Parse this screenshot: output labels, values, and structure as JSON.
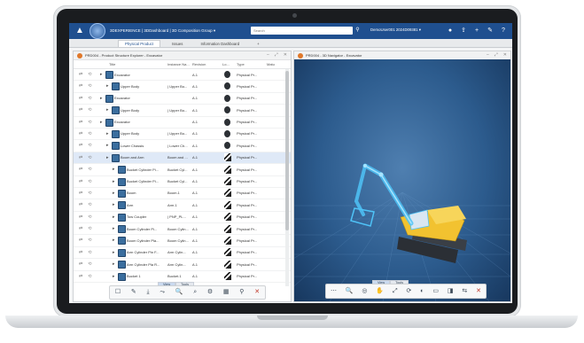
{
  "topbar": {
    "app_title": "3DEXPERIENCE | 3DDashboard | 3D Composition Group ▾",
    "search_placeholder": "Search",
    "user": "DemoUser001 2024D09381 ▾"
  },
  "tabs": [
    {
      "label": "Physical Product",
      "active": true
    },
    {
      "label": "Issues",
      "active": false
    },
    {
      "label": "Information Dashboard",
      "active": false
    },
    {
      "label": "+",
      "active": false
    }
  ],
  "left_panel": {
    "title": "PRD004 - Product Structure Explorer - Excavator",
    "controls": [
      "–",
      "⤢",
      "✕"
    ],
    "columns": [
      "Title",
      "Instance Na...",
      "Revision",
      "Lo...",
      "Type",
      "Matu"
    ],
    "rows": [
      {
        "indent": 0,
        "title": "Excavator",
        "instance": "",
        "revision": "A.1",
        "icon": "lock",
        "type": "Physical Pr...",
        "selected": false
      },
      {
        "indent": 1,
        "title": "Upper Body",
        "instance": "| Upper Bo...",
        "revision": "A.1",
        "icon": "lock",
        "type": "Physical Pr...",
        "selected": false
      },
      {
        "indent": 0,
        "title": "Excavator",
        "instance": "",
        "revision": "A.1",
        "icon": "lock",
        "type": "Physical Pr...",
        "selected": false
      },
      {
        "indent": 1,
        "title": "Upper Body",
        "instance": "| Upper Bo...",
        "revision": "A.1",
        "icon": "lock",
        "type": "Physical Pr...",
        "selected": false
      },
      {
        "indent": 0,
        "title": "Excavator",
        "instance": "",
        "revision": "A.1",
        "icon": "lock",
        "type": "Physical Pr...",
        "selected": false
      },
      {
        "indent": 1,
        "title": "Upper Body",
        "instance": "| Upper Bo...",
        "revision": "A.1",
        "icon": "lock",
        "type": "Physical Pr...",
        "selected": false
      },
      {
        "indent": 1,
        "title": "Lower Chassis",
        "instance": "| Lower Ch...",
        "revision": "A.1",
        "icon": "lock",
        "type": "Physical Pr...",
        "selected": false
      },
      {
        "indent": 1,
        "title": "Boom and Arm",
        "instance": "Boom and ...",
        "revision": "A.1",
        "icon": "thumb",
        "type": "Physical Pr...",
        "selected": true
      },
      {
        "indent": 2,
        "title": "Bucket Cylinder Pi...",
        "instance": "Bucket Cyl...",
        "revision": "A.1",
        "icon": "thumb",
        "type": "Physical Pr...",
        "selected": false
      },
      {
        "indent": 2,
        "title": "Bucket Cylinder Pi...",
        "instance": "Bucket Cyl...",
        "revision": "A.1",
        "icon": "thumb",
        "type": "Physical Pr...",
        "selected": false
      },
      {
        "indent": 2,
        "title": "Boom",
        "instance": "Boom.1",
        "revision": "A.1",
        "icon": "thumb",
        "type": "Physical Pr...",
        "selected": false
      },
      {
        "indent": 2,
        "title": "Arm",
        "instance": "Arm.1",
        "revision": "A.1",
        "icon": "thumb",
        "type": "Physical Pr...",
        "selected": false
      },
      {
        "indent": 2,
        "title": "Tow Coupler",
        "instance": "| PNP_PL...",
        "revision": "A.1",
        "icon": "thumb",
        "type": "Physical Pr...",
        "selected": false
      },
      {
        "indent": 2,
        "title": "Boom Cylinder Pi...",
        "instance": "Boom Cylin...",
        "revision": "A.1",
        "icon": "thumb",
        "type": "Physical Pr...",
        "selected": false
      },
      {
        "indent": 2,
        "title": "Boom Cylinder Pla...",
        "instance": "Boom Cylin...",
        "revision": "A.1",
        "icon": "thumb",
        "type": "Physical Pr...",
        "selected": false
      },
      {
        "indent": 2,
        "title": "Arm Cylinder Pin F...",
        "instance": "Arm Cylin...",
        "revision": "A.1",
        "icon": "thumb",
        "type": "Physical Pr...",
        "selected": false
      },
      {
        "indent": 2,
        "title": "Arm Cylinder Pla R...",
        "instance": "Arm Cylin...",
        "revision": "A.1",
        "icon": "thumb",
        "type": "Physical Pr...",
        "selected": false
      },
      {
        "indent": 2,
        "title": "Bucket 1",
        "instance": "Bucket.1",
        "revision": "A.1",
        "icon": "thumb",
        "type": "Physical Pr...",
        "selected": false
      }
    ],
    "bottom_tabs": [
      "View",
      "Tools"
    ],
    "toolbar": [
      "☐",
      "✎",
      "⤓",
      "⤳",
      "🔍",
      "⌕",
      "⚙",
      "▦",
      "⚲",
      "✕"
    ]
  },
  "right_panel": {
    "title": "PRD004 - 3D Navigator - Excavator",
    "controls": [
      "–",
      "⤢",
      "✕"
    ],
    "bottom_tabs": [
      "View",
      "Tools"
    ],
    "toolbar": [
      "⋯",
      "🔍",
      "◎",
      "✋",
      "⤢",
      "⟳",
      "◐",
      "▭",
      "◨",
      "⇆",
      "✕"
    ]
  },
  "colors": {
    "topbar": "#1f4f8f",
    "viewport": "#2c5b8d",
    "selection": "#dfe9f7",
    "excavator_body": "#f2c230",
    "excavator_highlight": "#4fc3f7"
  }
}
